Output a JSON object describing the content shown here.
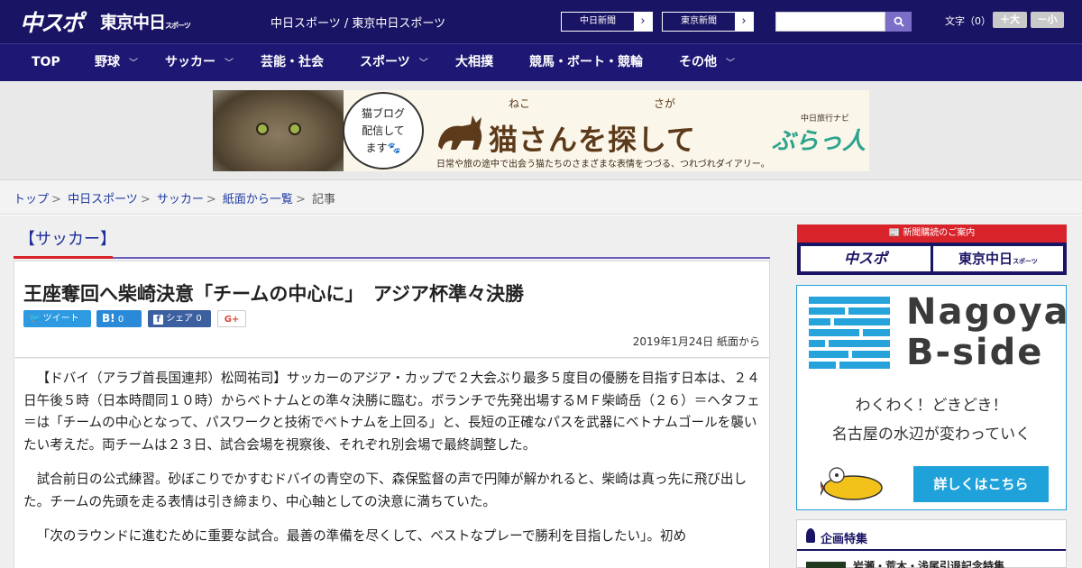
{
  "header": {
    "logo_chuspo": "中スポ",
    "logo_tokyo": "東京中日",
    "logo_tokyo_small": "スポーツ",
    "site_name": "中日スポーツ / 東京中日スポーツ",
    "ext_links": [
      "中日新聞",
      "東京新聞"
    ],
    "search": {
      "value": "",
      "placeholder": ""
    },
    "fontsize_label": "文字（0）",
    "fontsize_big": "＋大",
    "fontsize_small": "－小"
  },
  "nav": {
    "items": [
      {
        "label": "TOP",
        "has_menu": false
      },
      {
        "label": "野球",
        "has_menu": true
      },
      {
        "label": "サッカー",
        "has_menu": true
      },
      {
        "label": "芸能・社会",
        "has_menu": false
      },
      {
        "label": "スポーツ",
        "has_menu": true
      },
      {
        "label": "大相撲",
        "has_menu": false
      },
      {
        "label": "競馬・ボート・競輪",
        "has_menu": false
      },
      {
        "label": "その他",
        "has_menu": true
      }
    ]
  },
  "banner": {
    "bubble_lines": [
      "猫ブログ",
      "配信して",
      "ます🐾"
    ],
    "ruby_neko": "ねこ",
    "ruby_saga": "さが",
    "title": "猫さんを探して",
    "subtitle": "日常や旅の途中で出会う猫たちのさまざまな表情をつづる、つれづれダイアリー。",
    "brand_small": "中日旅行ナビ",
    "brand": "ぶらっ人"
  },
  "breadcrumb": {
    "items": [
      "トップ",
      "中日スポーツ",
      "サッカー",
      "紙面から一覧"
    ],
    "current": "記事"
  },
  "article": {
    "category": "【サッカー】",
    "title": "王座奪回へ柴崎決意「チームの中心に」　アジア杯準々決勝",
    "share": {
      "tweet": "ツイート",
      "hatena_count": "0",
      "fb_label": "シェア",
      "fb_count": "0",
      "gplus": "G+"
    },
    "date": "2019年1月24日 紙面から",
    "paragraphs": [
      "【ドバイ（アラブ首長国連邦）松岡祐司】サッカーのアジア・カップで２大会ぶり最多５度目の優勝を目指す日本は、２４日午後５時（日本時間同１０時）からベトナムとの準々決勝に臨む。ボランチで先発出場するＭＦ柴崎岳（２６）＝ヘタフェ＝は「チームの中心となって、パスワークと技術でベトナムを上回る」と、長短の正確なパスを武器にベトナムゴールを襲いたい考えだ。両チームは２３日、試合会場を視察後、それぞれ別会場で最終調整した。",
      "試合前日の公式練習。砂ぼこりでかすむドバイの青空の下、森保監督の声で円陣が解かれると、柴崎は真っ先に飛び出した。チームの先頭を走る表情は引き締まり、中心軸としての決意に満ちていた。",
      "「次のラウンドに進むために重要な試合。最善の準備を尽くして、ベストなプレーで勝利を目指したい」。初め"
    ]
  },
  "sidebar": {
    "subscription": {
      "heading": "新聞購読のご案内",
      "chuspo": "中スポ",
      "tokyo": "東京中日",
      "tokyo_small": "スポーツ"
    },
    "bside": {
      "title_line1": "Nagoya",
      "title_line2": "B-side",
      "line1": "わくわく！どきどき！",
      "line2": "名古屋の水辺が変わっていく",
      "button": "詳しくはこちら"
    },
    "feature": {
      "heading": "企画特集",
      "item": "岩瀬・荒木・浅尾引退記念特集"
    }
  },
  "colors": {
    "header_bg": "#1a1464",
    "accent_red": "#d8232a",
    "accent_purple": "#6a5bbf",
    "link_blue": "#1f3aa0",
    "bside_blue": "#1fa1d9"
  }
}
